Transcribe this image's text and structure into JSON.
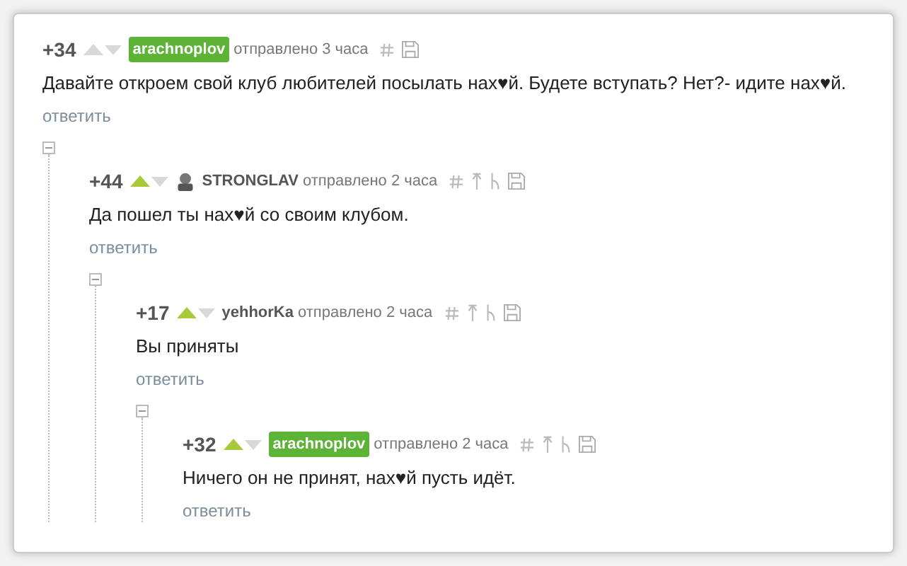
{
  "comments": [
    {
      "score": "+34",
      "upvoted": false,
      "author": "arachnoplov",
      "author_badge": true,
      "avatar": false,
      "time": "отправлено 3 часа",
      "parent_links": false,
      "text": "Давайте откроем свой клуб любителей посылать нах♥й. Будете вступать? Нет?- идите нах♥й.",
      "reply": "ответить",
      "expanded": true,
      "children": [
        {
          "score": "+44",
          "upvoted": true,
          "author": "STRONGLAV",
          "author_badge": false,
          "avatar": true,
          "time": "отправлено 2 часа",
          "parent_links": true,
          "text": "Да пошел ты нах♥й со своим клубом.",
          "reply": "ответить",
          "expanded": true,
          "children": [
            {
              "score": "+17",
              "upvoted": true,
              "author": "yehhorKa",
              "author_badge": false,
              "avatar": false,
              "time": "отправлено 2 часа",
              "parent_links": true,
              "text": "Вы приняты",
              "reply": "ответить",
              "expanded": true,
              "children": [
                {
                  "score": "+32",
                  "upvoted": true,
                  "author": "arachnoplov",
                  "author_badge": true,
                  "avatar": false,
                  "time": "отправлено 2 часа",
                  "parent_links": true,
                  "text": "Ничего он не принят, нах♥й пусть идёт.",
                  "reply": "ответить"
                }
              ]
            }
          ]
        }
      ]
    }
  ]
}
